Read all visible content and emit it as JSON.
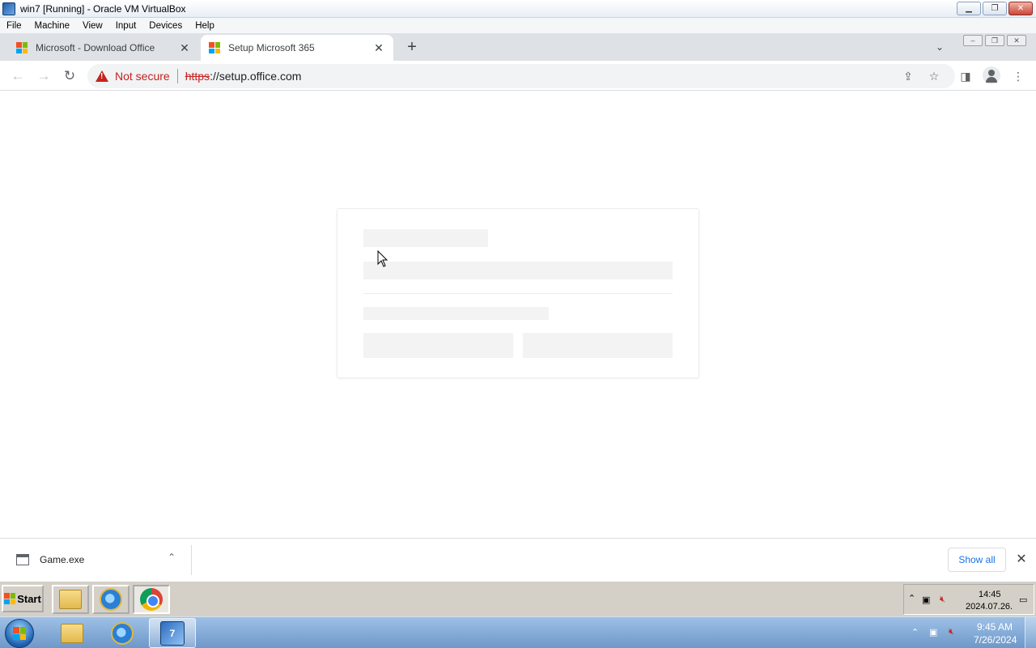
{
  "vbox": {
    "title": "win7 [Running] - Oracle VM VirtualBox",
    "menu": [
      "File",
      "Machine",
      "View",
      "Input",
      "Devices",
      "Help"
    ]
  },
  "browser": {
    "tabs": [
      {
        "title": "Microsoft - Download Office",
        "active": false
      },
      {
        "title": "Setup Microsoft 365",
        "active": true
      }
    ],
    "security_label": "Not secure",
    "url_scheme": "https",
    "url_rest": "://setup.office.com"
  },
  "download_bar": {
    "file_name": "Game.exe",
    "show_all_label": "Show all"
  },
  "guest_taskbar": {
    "start_label": "Start",
    "clock_time": "14:45",
    "clock_date": "2024.07.26."
  },
  "host_taskbar": {
    "clock_time": "9:45 AM",
    "clock_date": "7/26/2024",
    "vbox_badge": "7"
  },
  "colors": {
    "ms_red": "#f25022",
    "ms_green": "#7fba00",
    "ms_blue": "#00a4ef",
    "ms_yellow": "#ffb900",
    "warning_red": "#c5221f",
    "link_blue": "#1a73e8"
  }
}
